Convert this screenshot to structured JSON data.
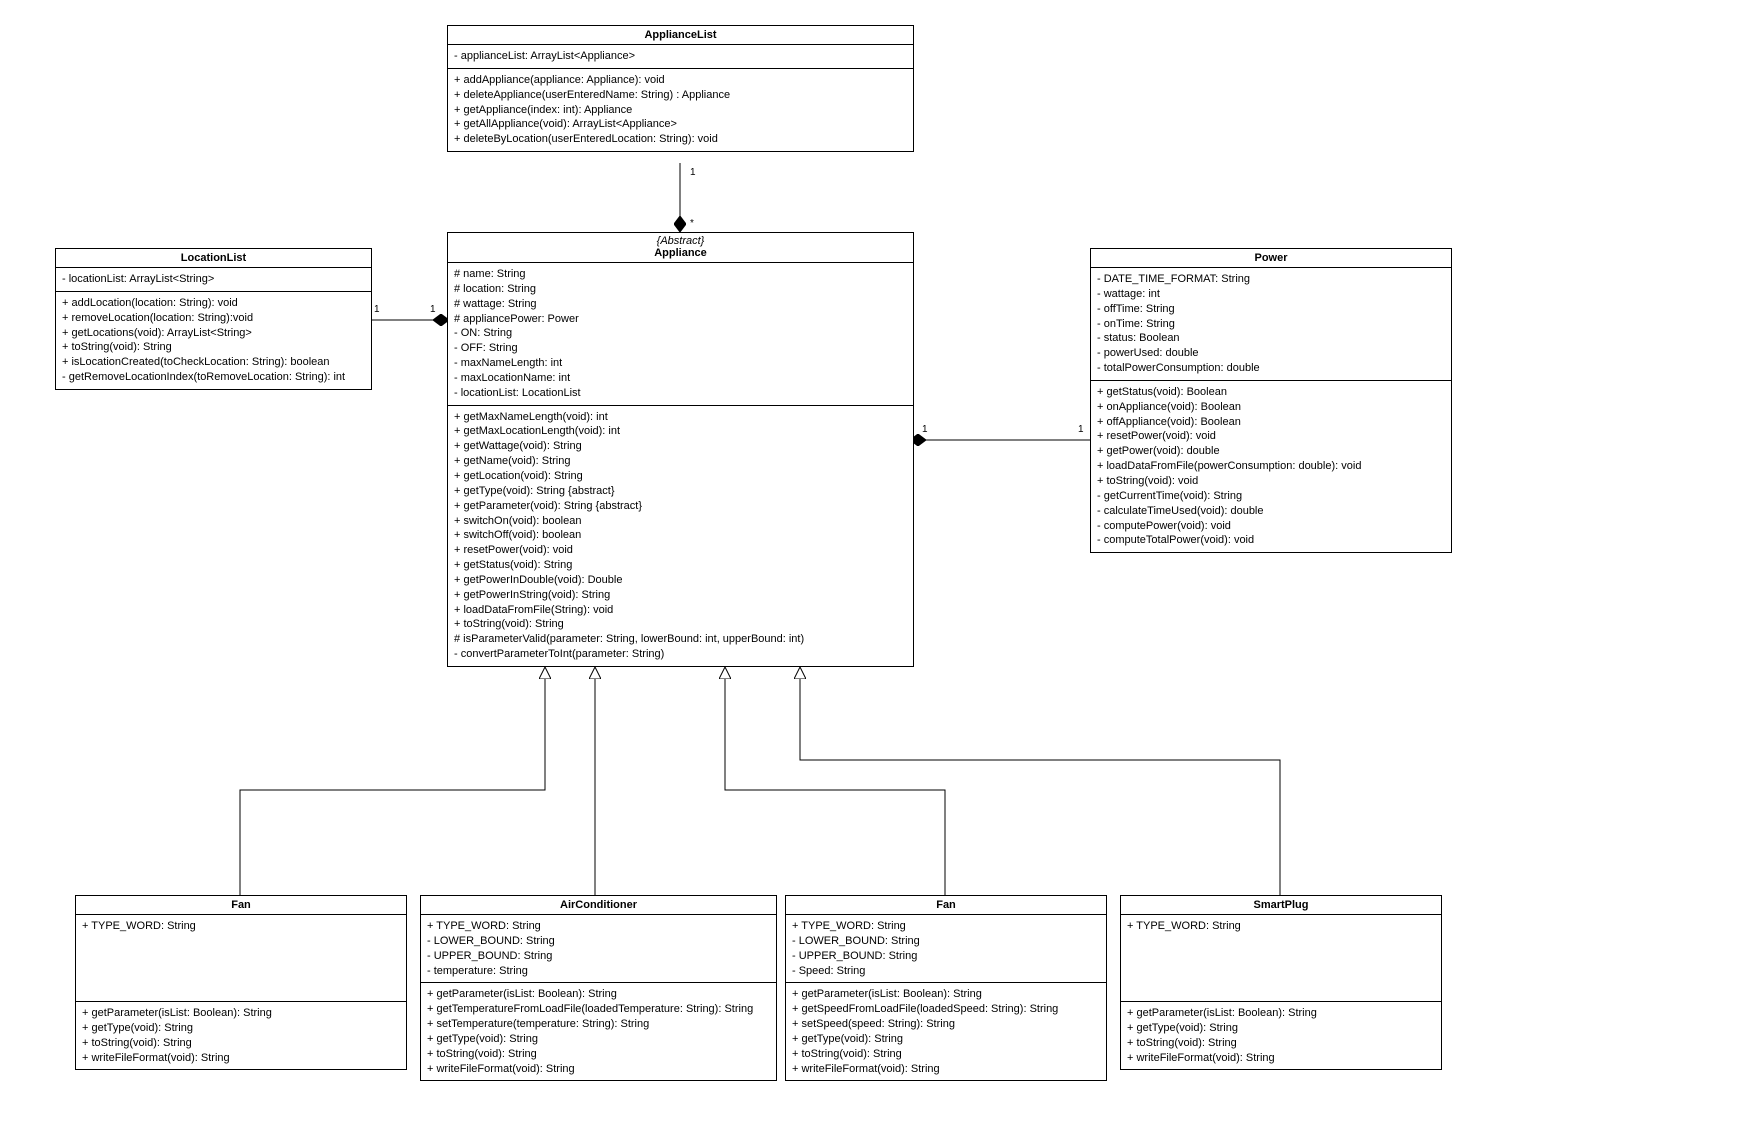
{
  "classes": {
    "ApplianceList": {
      "title": "ApplianceList",
      "attrs": [
        "- applianceList: ArrayList<Appliance>"
      ],
      "ops": [
        "+ addAppliance(appliance: Appliance): void",
        "+ deleteAppliance(userEnteredName: String) : Appliance",
        "+ getAppliance(index: int): Appliance",
        "+ getAllAppliance(void): ArrayList<Appliance>",
        "+ deleteByLocation(userEnteredLocation: String): void"
      ]
    },
    "LocationList": {
      "title": "LocationList",
      "attrs": [
        "- locationList: ArrayList<String>"
      ],
      "ops": [
        "+ addLocation(location: String): void",
        "+ removeLocation(location: String):void",
        "+ getLocations(void): ArrayList<String>",
        "+ toString(void): String",
        "+ isLocationCreated(toCheckLocation: String): boolean",
        "- getRemoveLocationIndex(toRemoveLocation: String): int"
      ]
    },
    "Appliance": {
      "stereotype": "{Abstract}",
      "title": "Appliance",
      "attrs": [
        "# name: String",
        "# location: String",
        "# wattage: String",
        "# appliancePower: Power",
        "- ON: String",
        "- OFF: String",
        "- maxNameLength: int",
        "- maxLocationName: int",
        "- locationList: LocationList"
      ],
      "ops": [
        "+ getMaxNameLength(void): int",
        "+ getMaxLocationLength(void): int",
        "+ getWattage(void): String",
        "+ getName(void): String",
        "+ getLocation(void): String",
        "+ getType(void):  String {abstract}",
        "+ getParameter(void): String {abstract}",
        "+ switchOn(void): boolean",
        "+ switchOff(void): boolean",
        "+ resetPower(void): void",
        "+ getStatus(void): String",
        "+ getPowerInDouble(void): Double",
        "+ getPowerInString(void): String",
        "+ loadDataFromFile(String): void",
        "+ toString(void): String",
        "# isParameterValid(parameter: String, lowerBound: int, upperBound: int)",
        "- convertParameterToInt(parameter: String)"
      ]
    },
    "Power": {
      "title": "Power",
      "attrs": [
        "- DATE_TIME_FORMAT: String",
        "- wattage: int",
        "- offTime: String",
        "- onTime: String",
        "- status: Boolean",
        "- powerUsed: double",
        "- totalPowerConsumption: double"
      ],
      "ops": [
        "+ getStatus(void): Boolean",
        "+ onAppliance(void): Boolean",
        "+ offAppliance(void): Boolean",
        "+ resetPower(void): void",
        "+ getPower(void): double",
        "+ loadDataFromFile(powerConsumption: double): void",
        "+ toString(void): void",
        "- getCurrentTime(void): String",
        "- calculateTimeUsed(void): double",
        "- computePower(void): void",
        "- computeTotalPower(void): void"
      ]
    },
    "Fan1": {
      "title": "Fan",
      "attrs": [
        "+ TYPE_WORD: String"
      ],
      "ops": [
        "+ getParameter(isList: Boolean): String",
        "+ getType(void): String",
        "+ toString(void): String",
        "+ writeFileFormat(void): String"
      ]
    },
    "AirConditioner": {
      "title": "AirConditioner",
      "attrs": [
        "+ TYPE_WORD: String",
        "- LOWER_BOUND: String",
        "- UPPER_BOUND: String",
        "- temperature: String"
      ],
      "ops": [
        "+ getParameter(isList: Boolean): String",
        "+ getTemperatureFromLoadFile(loadedTemperature: String): String",
        "+ setTemperature(temperature: String): String",
        "+ getType(void): String",
        "+ toString(void): String",
        "+ writeFileFormat(void): String"
      ]
    },
    "Fan2": {
      "title": "Fan",
      "attrs": [
        "+ TYPE_WORD: String",
        "- LOWER_BOUND: String",
        "- UPPER_BOUND: String",
        "- Speed: String"
      ],
      "ops": [
        "+ getParameter(isList: Boolean): String",
        "+ getSpeedFromLoadFile(loadedSpeed: String): String",
        "+ setSpeed(speed: String): String",
        "+ getType(void): String",
        "+ toString(void): String",
        "+ writeFileFormat(void): String"
      ]
    },
    "SmartPlug": {
      "title": "SmartPlug",
      "attrs": [
        "+ TYPE_WORD: String"
      ],
      "ops": [
        "+ getParameter(isList: Boolean): String",
        "+ getType(void): String",
        "+ toString(void): String",
        "+ writeFileFormat(void): String"
      ]
    }
  },
  "multiplicities": {
    "al_top": "1",
    "ap_top": "*",
    "ap_left": "1",
    "ll_right": "1",
    "ap_right": "1",
    "pw_left": "1"
  }
}
